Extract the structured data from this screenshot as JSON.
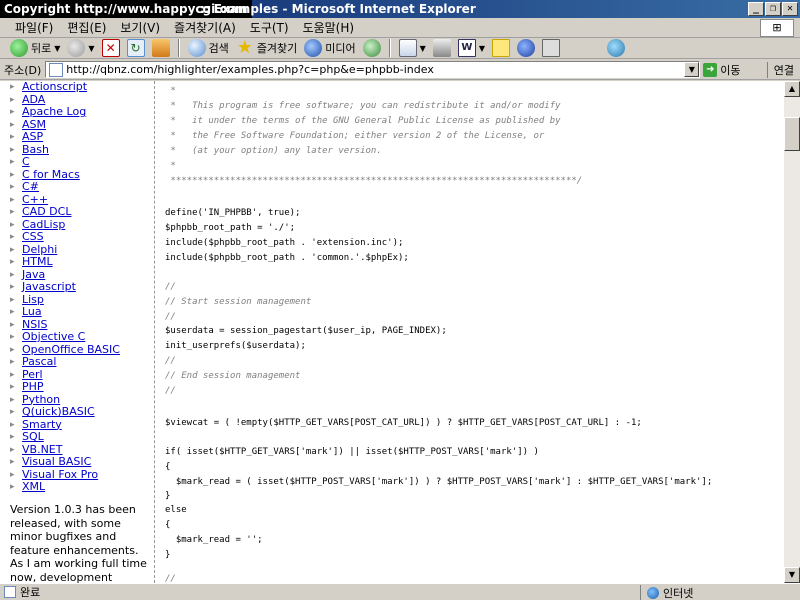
{
  "window": {
    "copyright": "Copyright   http://www.happycgi.com",
    "title": ":: Examples - Microsoft Internet Explorer"
  },
  "menu": [
    "파일(F)",
    "편집(E)",
    "보기(V)",
    "즐겨찾기(A)",
    "도구(T)",
    "도움말(H)"
  ],
  "toolbar": {
    "back": "뒤로",
    "search": "검색",
    "favorites": "즐겨찾기",
    "media": "미디어"
  },
  "address": {
    "label": "주소(D)",
    "url": "http://qbnz.com/highlighter/examples.php?c=php&e=phpbb-index",
    "go": "이동",
    "links": "연결"
  },
  "languages": [
    "Actionscript",
    "ADA",
    "Apache Log",
    "ASM",
    "ASP",
    "Bash",
    "C",
    "C for Macs",
    "C#",
    "C++",
    "CAD DCL",
    "CadLisp",
    "CSS",
    "Delphi",
    "HTML",
    "Java",
    "Javascript",
    "Lisp",
    "Lua",
    "NSIS",
    "Objective C",
    "OpenOffice BASIC",
    "Pascal",
    "Perl",
    "PHP",
    "Python",
    "Q(uick)BASIC",
    "Smarty",
    "SQL",
    "VB.NET",
    "Visual BASIC",
    "Visual Fox Pro",
    "XML"
  ],
  "release_note": "Version 1.0.3 has been released, with some minor bugfixes and feature enhancements. As I am working full time now, development",
  "code": [
    {
      "cls": "cm",
      "text": " *"
    },
    {
      "cls": "cm",
      "text": " *   This program is free software; you can redistribute it and/or modify"
    },
    {
      "cls": "cm",
      "text": " *   it under the terms of the GNU General Public License as published by"
    },
    {
      "cls": "cm",
      "text": " *   the Free Software Foundation; either version 2 of the License, or"
    },
    {
      "cls": "cm",
      "text": " *   (at your option) any later version."
    },
    {
      "cls": "cm",
      "text": " *"
    },
    {
      "cls": "cm",
      "text": " ***************************************************************************/"
    },
    {
      "cls": "plain",
      "text": ""
    },
    {
      "cls": "plain",
      "text": "define('IN_PHPBB', true);"
    },
    {
      "cls": "plain",
      "text": "$phpbb_root_path = './';"
    },
    {
      "cls": "plain",
      "text": "include($phpbb_root_path . 'extension.inc');"
    },
    {
      "cls": "plain",
      "text": "include($phpbb_root_path . 'common.'.$phpEx);"
    },
    {
      "cls": "plain",
      "text": ""
    },
    {
      "cls": "cm",
      "text": "//"
    },
    {
      "cls": "cm",
      "text": "// Start session management"
    },
    {
      "cls": "cm",
      "text": "//"
    },
    {
      "cls": "plain",
      "text": "$userdata = session_pagestart($user_ip, PAGE_INDEX);"
    },
    {
      "cls": "plain",
      "text": "init_userprefs($userdata);"
    },
    {
      "cls": "cm",
      "text": "//"
    },
    {
      "cls": "cm",
      "text": "// End session management"
    },
    {
      "cls": "cm",
      "text": "//"
    },
    {
      "cls": "plain",
      "text": ""
    },
    {
      "cls": "plain",
      "text": "$viewcat = ( !empty($HTTP_GET_VARS[POST_CAT_URL]) ) ? $HTTP_GET_VARS[POST_CAT_URL] : -1;"
    },
    {
      "cls": "plain",
      "text": ""
    },
    {
      "cls": "plain",
      "text": "if( isset($HTTP_GET_VARS['mark']) || isset($HTTP_POST_VARS['mark']) )"
    },
    {
      "cls": "plain",
      "text": "{"
    },
    {
      "cls": "plain",
      "text": "  $mark_read = ( isset($HTTP_POST_VARS['mark']) ) ? $HTTP_POST_VARS['mark'] : $HTTP_GET_VARS['mark'];"
    },
    {
      "cls": "plain",
      "text": "}"
    },
    {
      "cls": "plain",
      "text": "else"
    },
    {
      "cls": "plain",
      "text": "{"
    },
    {
      "cls": "plain",
      "text": "  $mark_read = '';"
    },
    {
      "cls": "plain",
      "text": "}"
    },
    {
      "cls": "cm",
      "text": ""
    },
    {
      "cls": "cm",
      "text": "//"
    }
  ],
  "status": {
    "text": "완료",
    "zone": "인터넷"
  }
}
